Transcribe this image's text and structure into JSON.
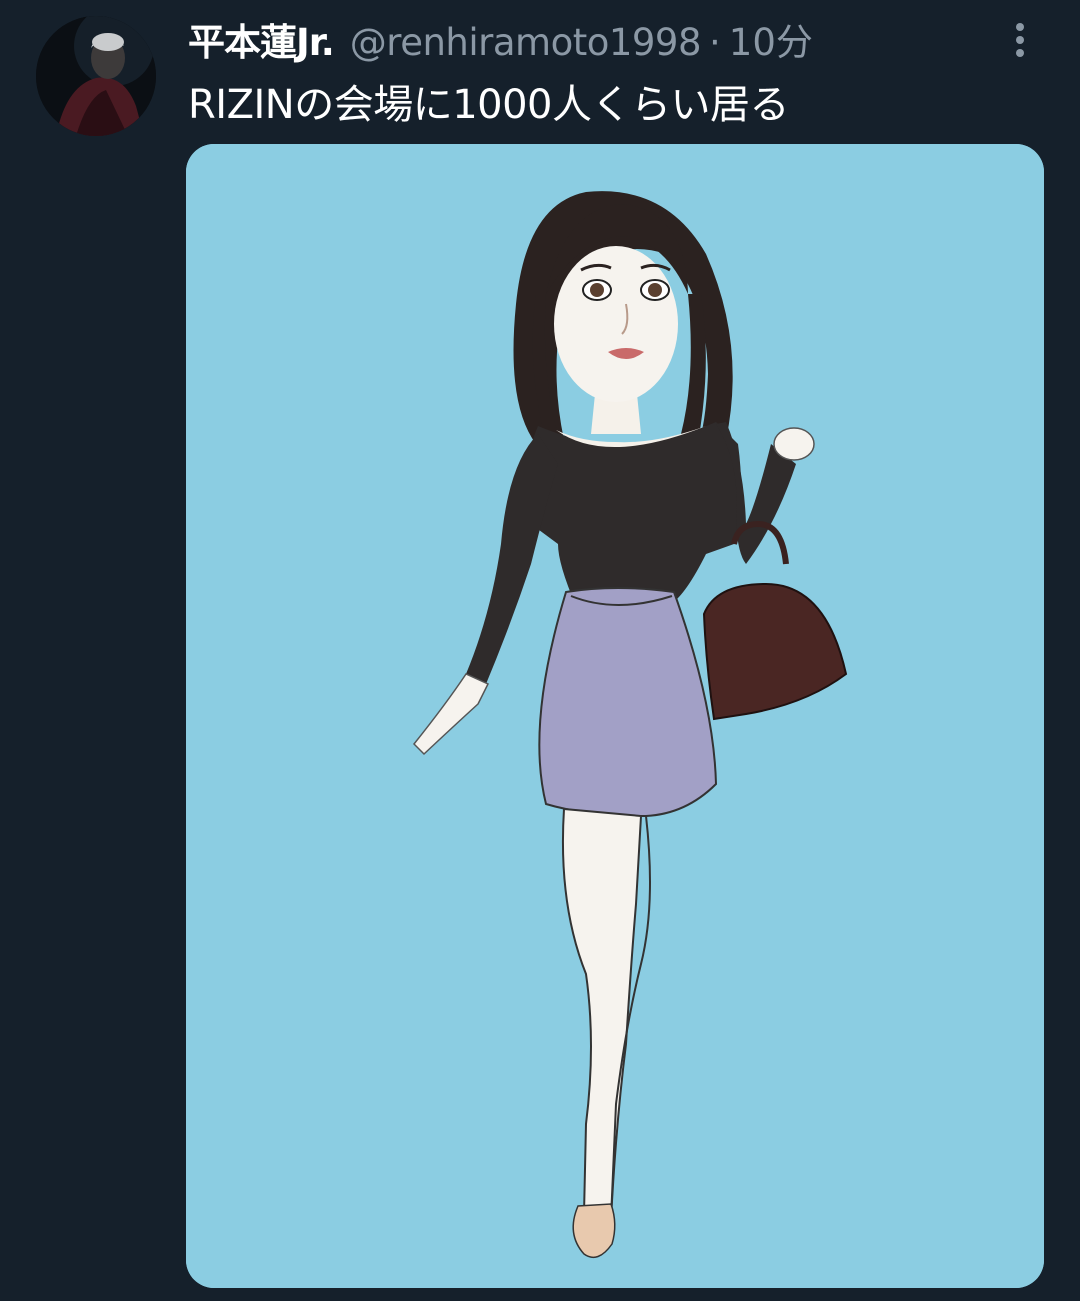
{
  "tweet": {
    "display_name": "平本蓮Jr.",
    "handle": "@renhiramoto1998",
    "separator": "·",
    "time": "10分",
    "text": "RIZINの会場に1000人くらい居る"
  },
  "icons": {
    "more": "more-vertical-icon"
  },
  "colors": {
    "background": "#15202b",
    "secondary_text": "#8b98a5",
    "media_background": "#8bcde2"
  }
}
